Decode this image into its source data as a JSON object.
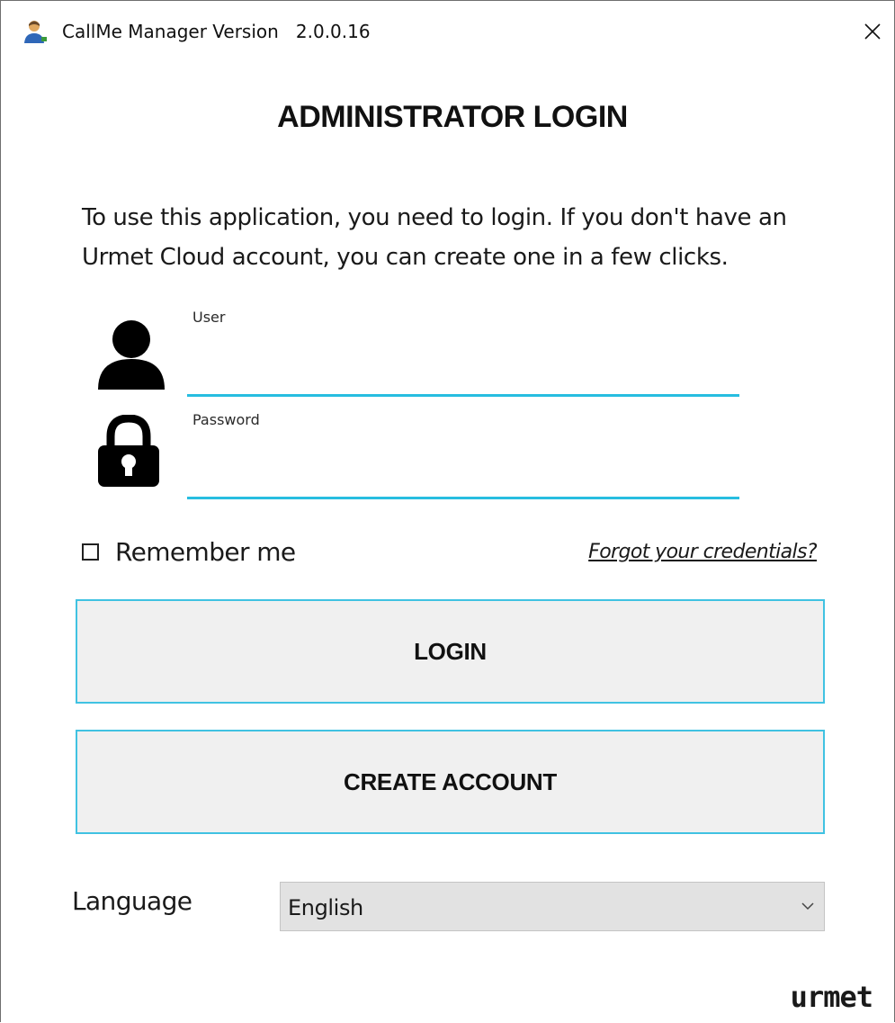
{
  "window": {
    "title": "CallMe Manager Version   2.0.0.16",
    "app_icon": "person-icon",
    "close_icon": "close-icon"
  },
  "login": {
    "heading": "ADMINISTRATOR LOGIN",
    "intro": "To use this application, you need to login. If you don't have an Urmet Cloud account, you can create one in a few clicks.",
    "user_label": "User",
    "user_value": "",
    "user_icon": "user-icon",
    "password_label": "Password",
    "password_value": "",
    "password_icon": "lock-icon",
    "remember_label": "Remember me",
    "remember_checked": false,
    "forgot_link": "Forgot your credentials?",
    "login_button": "LOGIN",
    "create_button": "CREATE ACCOUNT"
  },
  "language": {
    "label": "Language",
    "selected": "English"
  },
  "brand": {
    "logo_text": "urmet"
  },
  "colors": {
    "accent": "#27bde0",
    "button_bg": "#f0f0f0",
    "select_bg": "#e2e2e2"
  }
}
